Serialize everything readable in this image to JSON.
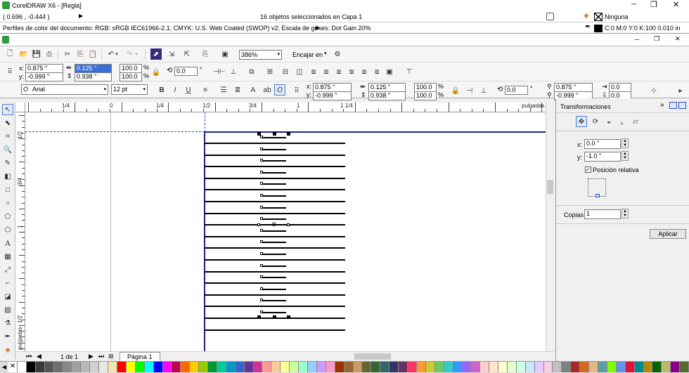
{
  "window": {
    "title": "CorelDRAW X6 - [Regla]",
    "status_selection": "16 objetos seleccionados en Capa 1",
    "coords": "( 0.696 , -0.444 )",
    "fill_label": "Ninguna",
    "outline_label": "C:0 M:0 Y:0 K:100  0.010 in",
    "profile": "Perfiles de color del documento: RGB: sRGB IEC61966-2.1; CMYK: U.S. Web Coated (SWOP) v2; Escala de grises: Dot Gain 20%"
  },
  "std": {
    "zoom": "386%",
    "snap": "Encajar en"
  },
  "prop": {
    "x": "0.875 \"",
    "y": "-0.999 \"",
    "w": "0.125 \"",
    "h": "0.938 \"",
    "sx": "100.0",
    "sy": "100.0",
    "pct": "%",
    "rot": "0.0",
    "deg": "°",
    "x_label": "x:",
    "y_label": "y:"
  },
  "text": {
    "font": "Arial",
    "size": "12 pt",
    "x": "0.875 \"",
    "y": "-0.999 \"",
    "w": "0.125 \"",
    "h": "0.938 \"",
    "sx": "100.0",
    "sy": "100.0",
    "rot": "0.0",
    "px": "0.875 \"",
    "py": "-0.999 \"",
    "a": "0.0",
    "b": "0.0"
  },
  "ruler": {
    "units": "pulgadas",
    "h_labels": [
      "1/4",
      "0",
      "1/4",
      "1/2",
      "3/4",
      "1",
      "1 1/4"
    ],
    "v_labels": [
      "1/2",
      "3/4",
      "1",
      "1/2"
    ],
    "v_units": "pulgadas"
  },
  "docker": {
    "title": "Transformaciones",
    "x_label": "x:",
    "x_value": "0.0 \"",
    "y_label": "y:",
    "y_value": "-1.0 \"",
    "relative": "Posición relativa",
    "copies_label": "Copias:",
    "copies_value": "1",
    "apply": "Aplicar"
  },
  "nav": {
    "page_count": "1 de 1",
    "page_tab": "Página 1"
  },
  "colors": {
    "palette": [
      "#ffffff",
      "#000000",
      "#3a3a3a",
      "#555555",
      "#6e6e6e",
      "#888888",
      "#a0a0a0",
      "#b8b8b8",
      "#d0d0d0",
      "#e8e8e8",
      "#f5e6b0",
      "#ff0000",
      "#ffff00",
      "#00ff00",
      "#00ffff",
      "#0000ff",
      "#ff00ff",
      "#c00050",
      "#ff6600",
      "#ffcc00",
      "#99cc00",
      "#009933",
      "#00cc99",
      "#0099cc",
      "#3366cc",
      "#663399",
      "#cc3399",
      "#ff9999",
      "#ffcc99",
      "#ffff99",
      "#ccff99",
      "#99ffcc",
      "#99ccff",
      "#cc99ff",
      "#ff99cc",
      "#993300",
      "#996633",
      "#cc9966",
      "#666633",
      "#336633",
      "#336666",
      "#333366",
      "#663366",
      "#ff3366",
      "#ff9933",
      "#cccc33",
      "#66cc66",
      "#33cccc",
      "#3399ff",
      "#9966ff",
      "#cc66cc",
      "#ffcccc",
      "#ffe5cc",
      "#ffffcc",
      "#e5ffcc",
      "#ccffe5",
      "#cce5ff",
      "#e5ccff",
      "#ffcce5",
      "#c0c0c0",
      "#808080",
      "#a52a2a",
      "#d2691e",
      "#deb887",
      "#5f9ea0",
      "#7fff00",
      "#6495ed",
      "#dc143c",
      "#008b8b",
      "#b8860b",
      "#006400",
      "#bdb76b",
      "#8b008b",
      "#556b2f"
    ]
  }
}
